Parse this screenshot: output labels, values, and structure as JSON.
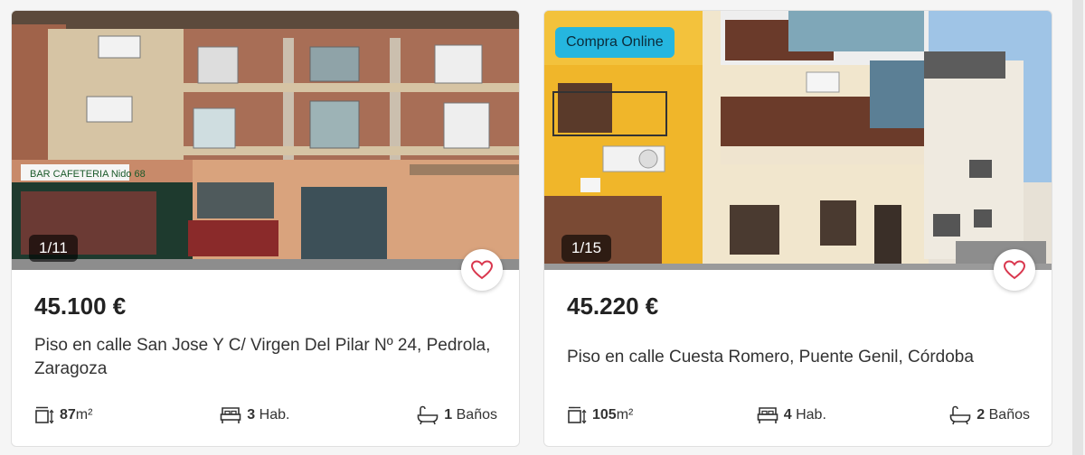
{
  "listings": [
    {
      "photo_counter": "1/11",
      "price": "45.100 €",
      "title": "Piso en calle San Jose Y C/ Virgen Del Pilar Nº 24, Pedrola, Zaragoza",
      "area_value": "87",
      "area_unit": "m²",
      "rooms_value": "3",
      "rooms_unit": "Hab.",
      "baths_value": "1",
      "baths_unit": "Baños",
      "sign_text": "BAR CAFETERIA Nido 68"
    },
    {
      "badge": "Compra Online",
      "photo_counter": "1/15",
      "price": "45.220 €",
      "title": "Piso en calle Cuesta Romero, Puente Genil, Córdoba",
      "area_value": "105",
      "area_unit": "m²",
      "rooms_value": "4",
      "rooms_unit": "Hab.",
      "baths_value": "2",
      "baths_unit": "Baños"
    }
  ],
  "colors": {
    "badge_bg": "#25b6df",
    "heart": "#d9374e"
  },
  "icons": [
    "area-icon",
    "bed-icon",
    "bathtub-icon",
    "heart-icon"
  ]
}
